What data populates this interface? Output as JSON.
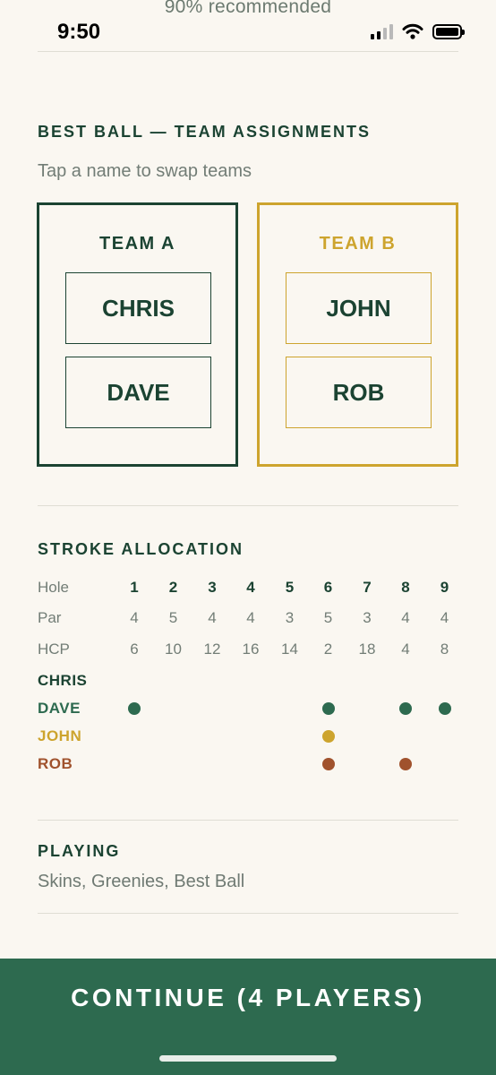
{
  "status_bar": {
    "zoom_notice": "90% recommended",
    "time": "9:50"
  },
  "teams": {
    "heading": "BEST BALL — TEAM ASSIGNMENTS",
    "hint": "Tap a name to swap teams",
    "team_a": {
      "name": "TEAM A",
      "players": [
        "CHRIS",
        "DAVE"
      ],
      "color": "#1b4332"
    },
    "team_b": {
      "name": "TEAM B",
      "players": [
        "JOHN",
        "ROB"
      ],
      "color": "#cda42e"
    }
  },
  "stroke_allocation": {
    "heading": "STROKE ALLOCATION",
    "hole_label": "Hole",
    "par_label": "Par",
    "hcp_label": "HCP",
    "holes": [
      "1",
      "2",
      "3",
      "4",
      "5",
      "6",
      "7",
      "8",
      "9"
    ],
    "par": [
      "4",
      "5",
      "4",
      "4",
      "3",
      "5",
      "3",
      "4",
      "4"
    ],
    "hcp": [
      "6",
      "10",
      "12",
      "16",
      "14",
      "2",
      "18",
      "4",
      "8"
    ],
    "players": [
      {
        "name": "CHRIS",
        "color": "#1b4332",
        "stroke_holes": []
      },
      {
        "name": "DAVE",
        "color": "#2d6a4f",
        "stroke_holes": [
          1,
          6,
          8,
          9
        ]
      },
      {
        "name": "JOHN",
        "color": "#cda42e",
        "stroke_holes": [
          6
        ]
      },
      {
        "name": "ROB",
        "color": "#a0522d",
        "stroke_holes": [
          6,
          8
        ]
      }
    ]
  },
  "playing": {
    "heading": "PLAYING",
    "games": "Skins, Greenies, Best Ball"
  },
  "footer": {
    "continue_label": "CONTINUE (4 PLAYERS)",
    "accent": "#2d6a4f"
  }
}
